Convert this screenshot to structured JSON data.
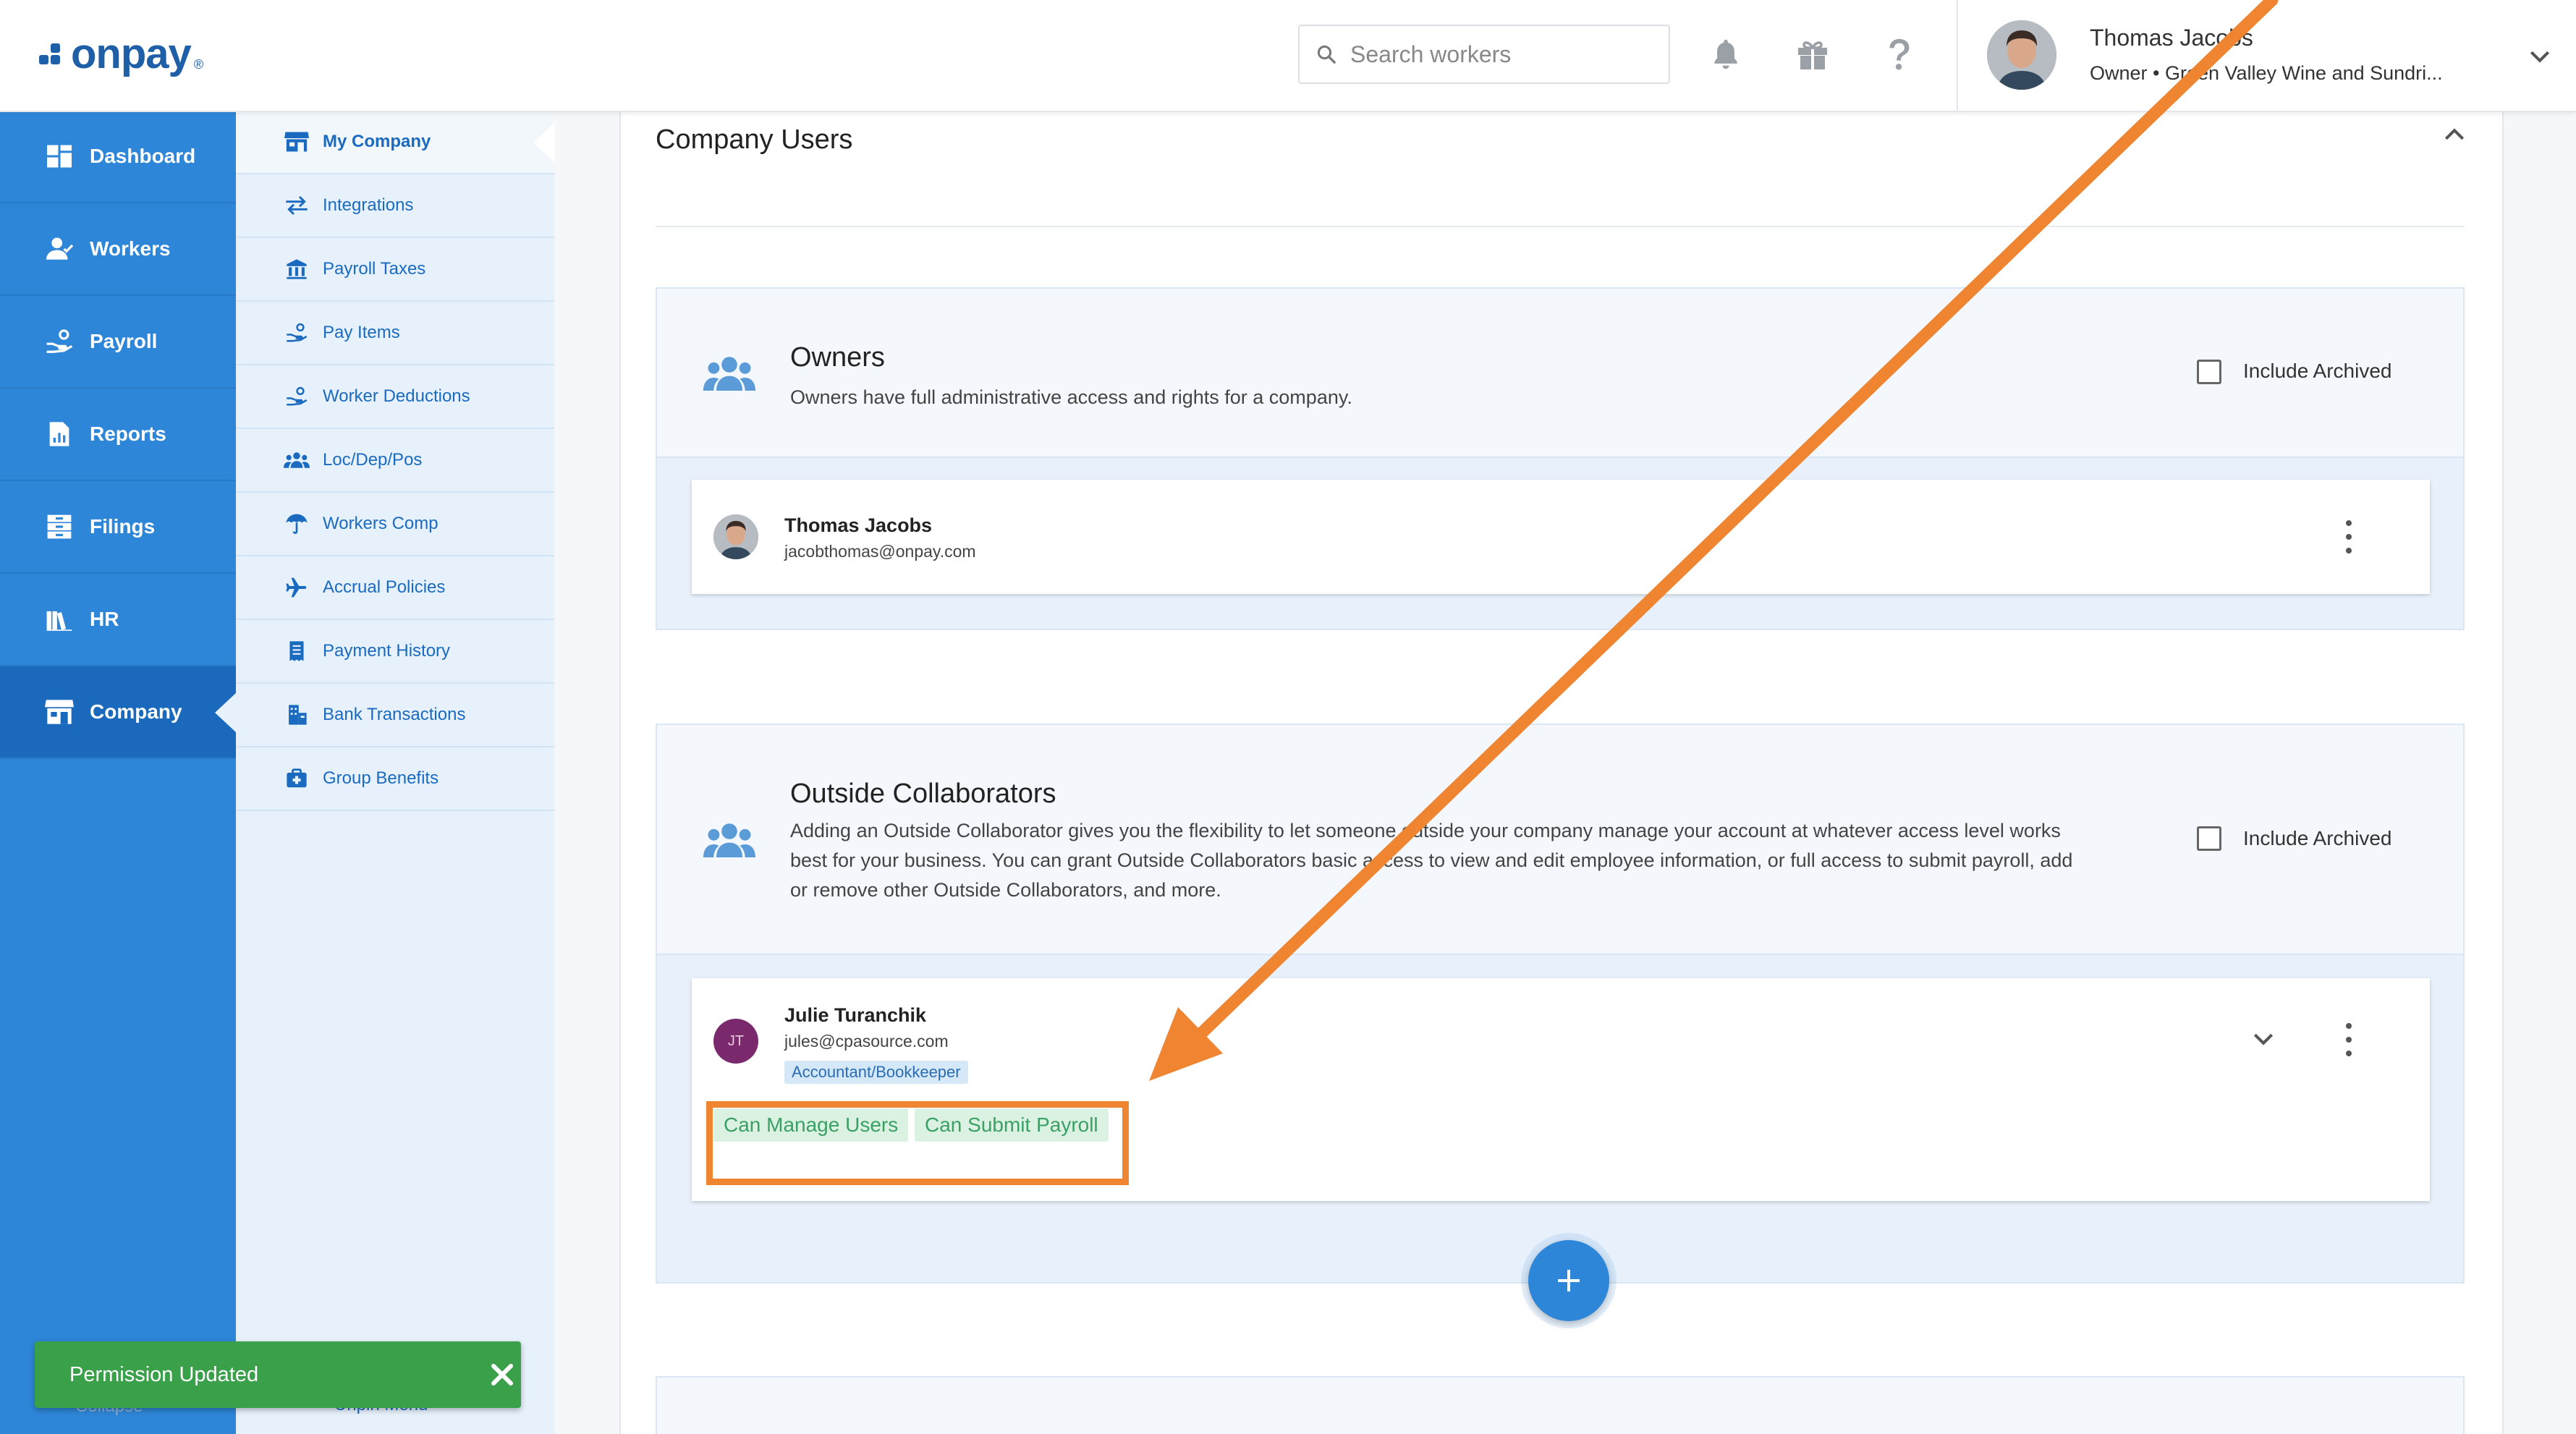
{
  "brand": {
    "logo_text": "onpay",
    "logo_mark": "®"
  },
  "header": {
    "search_placeholder": "Search workers",
    "user_name": "Thomas Jacobs",
    "user_role": "Owner • Green Valley Wine and Sundri..."
  },
  "sidebar": {
    "items": [
      {
        "label": "Dashboard",
        "icon": "dashboard-icon"
      },
      {
        "label": "Workers",
        "icon": "workers-icon"
      },
      {
        "label": "Payroll",
        "icon": "payroll-icon"
      },
      {
        "label": "Reports",
        "icon": "reports-icon"
      },
      {
        "label": "Filings",
        "icon": "filings-icon"
      },
      {
        "label": "HR",
        "icon": "hr-icon"
      },
      {
        "label": "Company",
        "icon": "company-icon"
      }
    ],
    "active": "Company",
    "collapse_label": "Collapse"
  },
  "subnav": {
    "items": [
      {
        "label": "My Company",
        "icon": "store-icon"
      },
      {
        "label": "Integrations",
        "icon": "swap-icon"
      },
      {
        "label": "Payroll Taxes",
        "icon": "bank-icon"
      },
      {
        "label": "Pay Items",
        "icon": "hand-coin-icon"
      },
      {
        "label": "Worker Deductions",
        "icon": "hand-coin-icon"
      },
      {
        "label": "Loc/Dep/Pos",
        "icon": "group-icon"
      },
      {
        "label": "Workers Comp",
        "icon": "umbrella-icon"
      },
      {
        "label": "Accrual Policies",
        "icon": "airplane-icon"
      },
      {
        "label": "Payment History",
        "icon": "receipt-icon"
      },
      {
        "label": "Bank Transactions",
        "icon": "bank-building-icon"
      },
      {
        "label": "Group Benefits",
        "icon": "medical-bag-icon"
      }
    ],
    "active": "My Company",
    "unpin_label": "Unpin Menu"
  },
  "main": {
    "title": "Company Users",
    "owners": {
      "title": "Owners",
      "description": "Owners have full administrative access and rights for a company.",
      "include_archived_label": "Include Archived",
      "users": [
        {
          "name": "Thomas Jacobs",
          "email": "jacobthomas@onpay.com"
        }
      ]
    },
    "collaborators": {
      "title": "Outside Collaborators",
      "description_lines": [
        "Adding an Outside Collaborator gives you the flexibility to let someone outside your company manage your account at whatever access level works",
        "best for your business. You can grant Outside Collaborators basic access to view and edit employee information, or full access to submit payroll, add",
        "or remove other Outside Collaborators, and more."
      ],
      "include_archived_label": "Include Archived",
      "users": [
        {
          "initials": "JT",
          "name": "Julie Turanchik",
          "email": "jules@cpasource.com",
          "role": "Accountant/Bookkeeper",
          "permissions": [
            "Can Manage Users",
            "Can Submit Payroll"
          ]
        }
      ]
    }
  },
  "toast": {
    "message": "Permission Updated"
  },
  "colors": {
    "primary": "#2e86d8",
    "primary_dark": "#1a69bc",
    "brand": "#1f5fa8",
    "success": "#3aa04a",
    "annotation": "#ef8431",
    "avatar_jt": "#7a2a6c"
  }
}
